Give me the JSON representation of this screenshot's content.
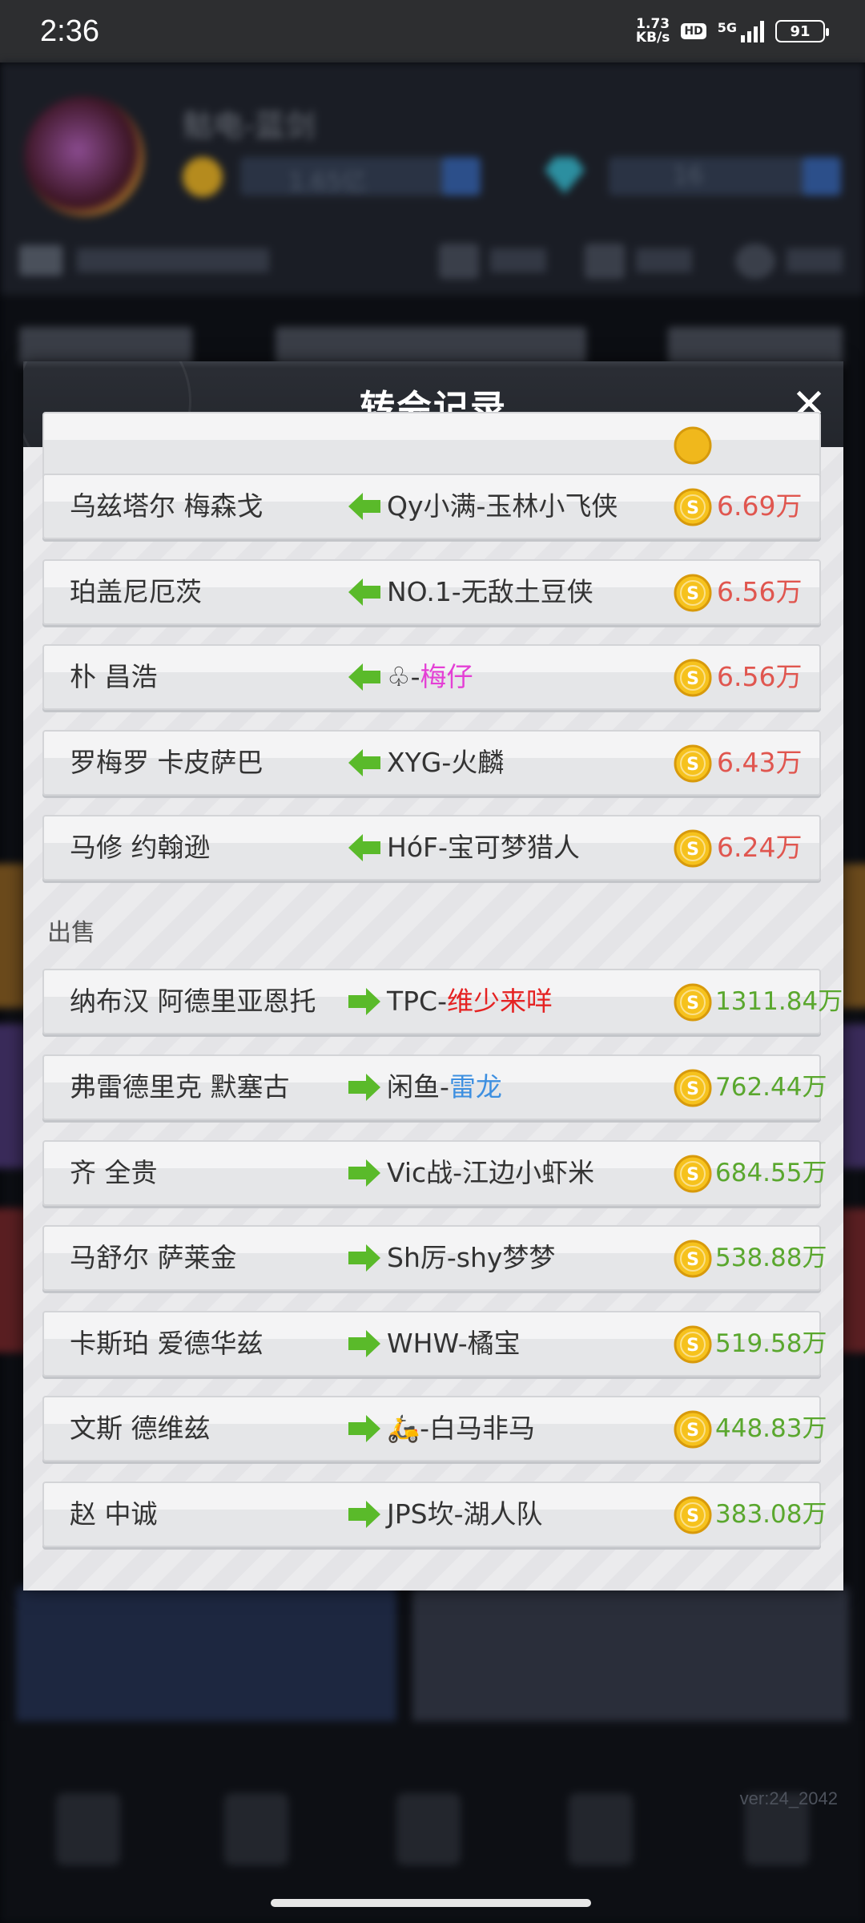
{
  "status_bar": {
    "time": "2:36",
    "net_speed_value": "1.73",
    "net_speed_unit": "KB/s",
    "hd": "HD",
    "network": "5G",
    "battery": "91"
  },
  "background": {
    "team_name": "骷电-蓝剑",
    "coin_balance": "1.65亿",
    "gem_balance": "16"
  },
  "modal": {
    "title": "转会记录",
    "close_icon": "close-icon",
    "sell_section_label": "出售",
    "colors": {
      "buy_price": "#e0564f",
      "sell_price": "#5aa72e",
      "buy_arrow": "#5aba2a",
      "sell_arrow": "#5aba2a"
    },
    "buy_rows": [
      {
        "player": "乌兹塔尔 梅森戈",
        "club": "Qy小满-玉林小飞侠",
        "price": "6.69万"
      },
      {
        "player": "珀盖尼厄茨",
        "club": "NO.1-无敌土豆侠",
        "price": "6.56万"
      },
      {
        "player": "朴 昌浩",
        "club_prefix": "♧-",
        "club_highlight": "梅仔",
        "price": "6.56万"
      },
      {
        "player": "罗梅罗 卡皮萨巴",
        "club": "XYG-火麟",
        "price": "6.43万"
      },
      {
        "player": "马修 约翰逊",
        "club": "HóF-宝可梦猎人",
        "price": "6.24万"
      }
    ],
    "sell_rows": [
      {
        "player": "纳布汉 阿德里亚恩托",
        "club_prefix": "TPC-",
        "club_highlight": "维少来咩",
        "price": "1311.84万"
      },
      {
        "player": "弗雷德里克 默塞古",
        "club_prefix": "闲鱼-",
        "club_highlight": "雷龙",
        "price": "762.44万"
      },
      {
        "player": "齐 全贵",
        "club": "Vic战-江边小虾米",
        "price": "684.55万"
      },
      {
        "player": "马舒尔 萨莱金",
        "club": "Sh厉-shy梦梦",
        "price": "538.88万"
      },
      {
        "player": "卡斯珀 爱德华兹",
        "club": "WHW-橘宝",
        "price": "519.58万"
      },
      {
        "player": "文斯 德维兹",
        "club_prefix": "🛵",
        "club": "-白马非马",
        "price": "448.83万"
      },
      {
        "player": "赵 中诚",
        "club": "JPS坎-湖人队",
        "price": "383.08万"
      }
    ]
  },
  "footer": {
    "version": "ver:24_2042"
  }
}
